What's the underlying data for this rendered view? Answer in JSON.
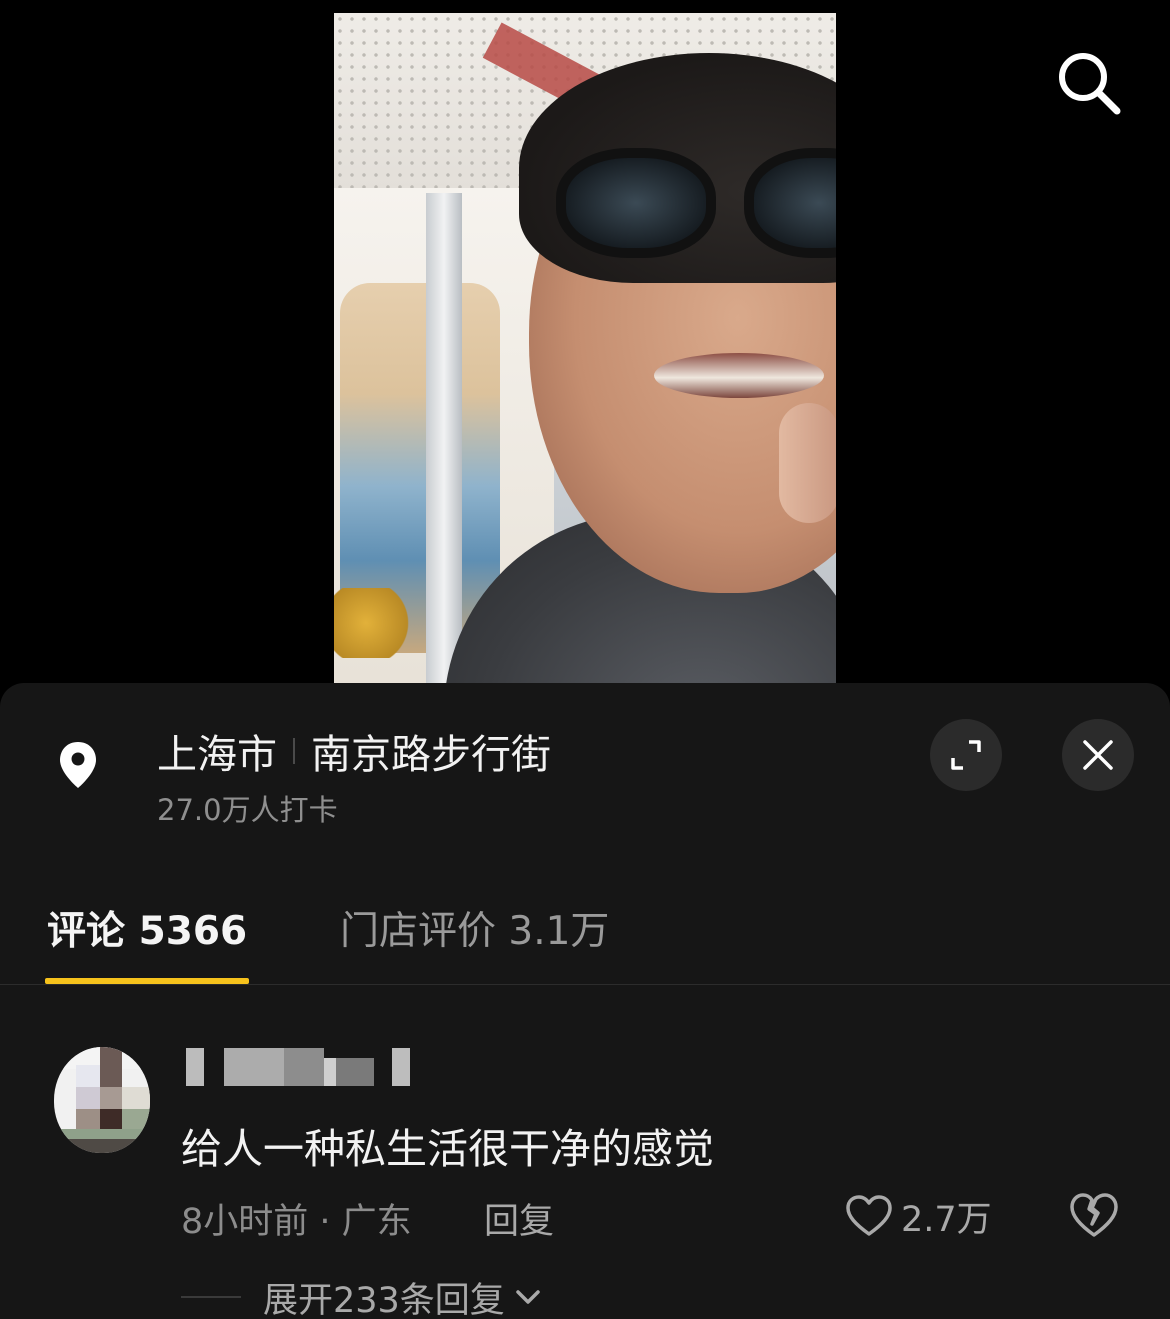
{
  "location": {
    "city": "上海市",
    "place": "南京路步行街",
    "checkins": "27.0万人打卡"
  },
  "tabs": {
    "comments": "评论 5366",
    "reviews": "门店评价 3.1万"
  },
  "comment": {
    "text": "给人一种私生活很干净的感觉",
    "meta": "8小时前 · 广东",
    "reply_label": "回复",
    "likes": "2.7万",
    "expand_label": "展开233条回复"
  },
  "colors": {
    "accent": "#f6c21c",
    "panel_bg": "#161616",
    "secondary_text": "#8c8c8c"
  },
  "icons": [
    "search-icon",
    "location-pin-icon",
    "expand-icon",
    "close-icon",
    "heart-icon",
    "broken-heart-icon",
    "chevron-down-icon"
  ]
}
